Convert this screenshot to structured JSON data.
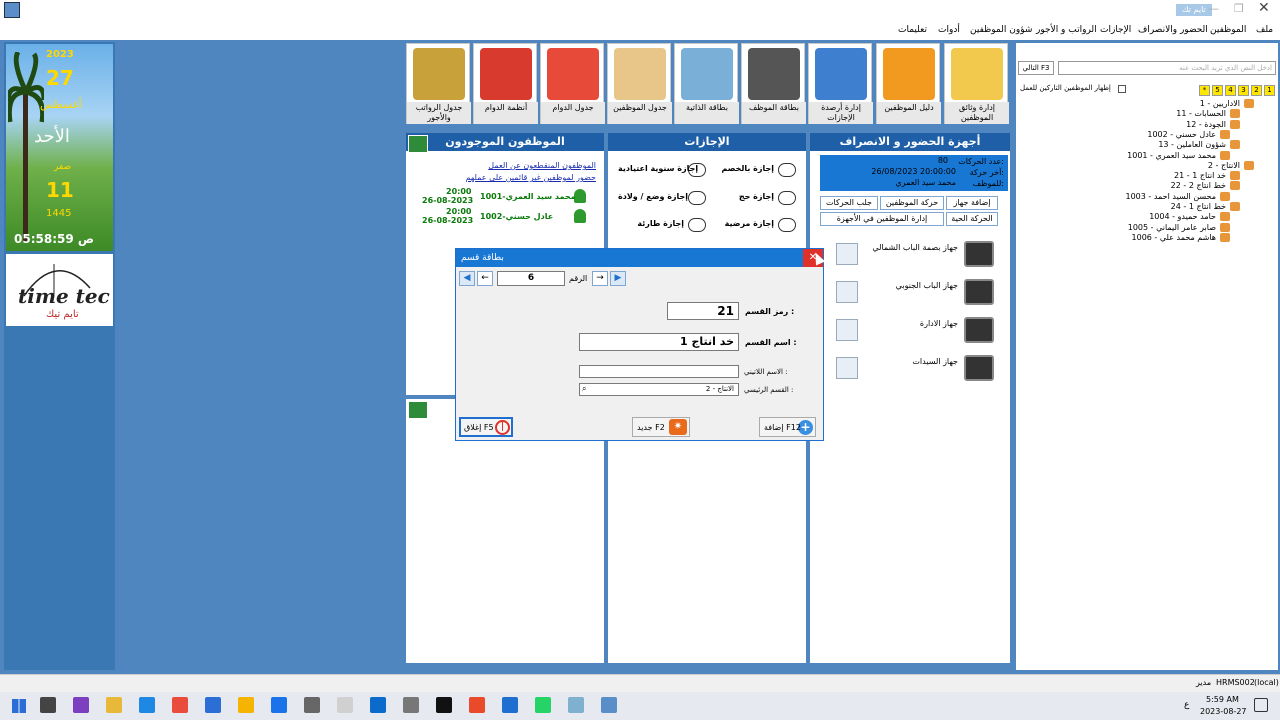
{
  "window": {
    "title": "تايم تك",
    "controls": [
      "✕",
      "❐",
      "—"
    ]
  },
  "menu": {
    "items": [
      "ملف",
      "الموظفين",
      "الحضور والانصراف",
      "الإجازات",
      "الرواتب و الأجور",
      "شؤون الموظفين",
      "أدوات",
      "تعليمات"
    ]
  },
  "date_panel": {
    "year": "2023",
    "day": "27",
    "month": "أغسطس",
    "weekday": "الأحد",
    "hijri_month": "صفر",
    "hijri_day": "11",
    "hijri_year": "1445",
    "time": "05:58:59 ص"
  },
  "logo": {
    "text": "time tec",
    "arabic": "تايم تيك"
  },
  "toolbar": {
    "items": [
      {
        "label": "إدارة وثائق الموظفين",
        "icon": "documents-icon",
        "color": "#f2c94c"
      },
      {
        "label": "دليل الموظفين",
        "icon": "folders-icon",
        "color": "#f29a1f"
      },
      {
        "label": "إدارة أرصدة الإجازات",
        "icon": "binders-icon",
        "color": "#3f7fcf"
      },
      {
        "label": "بطاقة الموظف",
        "icon": "person-icon",
        "color": "#555555"
      },
      {
        "label": "بطاقة الذاتية",
        "icon": "chart-board-icon",
        "color": "#7ab0d8"
      },
      {
        "label": "جدول الموظفين",
        "icon": "id-card-icon",
        "color": "#e8c68a"
      },
      {
        "label": "جدول الدوام",
        "icon": "timesheet-clock-icon",
        "color": "#e84a3a"
      },
      {
        "label": "أنظمة الدوام",
        "icon": "calendar-icon",
        "color": "#d93a2e"
      },
      {
        "label": "جدول الرواتب والأجور",
        "icon": "money-icon",
        "color": "#c9a13a"
      }
    ]
  },
  "attendance": {
    "title": "أجهزة الحضور و الانصراف",
    "stats": {
      "moves_label": "عدد الحركات:",
      "moves_value": "80",
      "last_label": "آخر حركة:",
      "last_value": "26/08/2023 20:00:00",
      "employee_label": "للموظف:",
      "employee_value": "محمد سيد العمري"
    },
    "buttons": [
      "إضافة جهاز",
      "حركة الموظفين",
      "جلب الحركات",
      "الحركة الحية",
      "إدارة الموظفين في الأجهزة"
    ],
    "devices": [
      "جهاز بصمة الباب الشمالي",
      "جهاز الباب الجنوبي",
      "جهاز الادارة",
      "جهاز السيدات"
    ]
  },
  "leaves": {
    "title": "الإجازات",
    "items": [
      "إجازة بالخصم",
      "إجازة سنوية اعتيادية",
      "إجازة حج",
      "إجازة وضع / ولادة",
      "إجازة مرضية",
      "إجازة طارئة"
    ]
  },
  "present": {
    "title": "الموظفون الموجودون",
    "links": [
      "الموظفون المنقطعون عن العمل",
      "حضور لموظفين غير قائمين على عملهم"
    ],
    "rows": [
      {
        "name": "1001-محمد سيد العمري",
        "time": "20:00",
        "date": "26-08-2023"
      },
      {
        "name": "1002-عادل حسني",
        "time": "20:00",
        "date": "26-08-2023"
      }
    ]
  },
  "dialog": {
    "title": "بطاقة قسم",
    "number_label": "الرقم",
    "number_value": "6",
    "code_label": "رمز القسم :",
    "code_value": "21",
    "name_label": "اسم القسم :",
    "name_value": "خد انتاج 1",
    "latin_label": "الاسم اللاتيني :",
    "parent_label": "القسم الرئيسي :",
    "parent_value": "2 - الانتاج",
    "add_label": "إضافة F12",
    "new_label": "جديد F2",
    "close_label": "إغلاق F5"
  },
  "right_panel": {
    "search_placeholder": "ادخل النص الذي تريد البحث عنه",
    "next_label": "التالي F3",
    "show_leavers": "إظهار الموظفين التاركين للعمل",
    "levels": [
      "1",
      "2",
      "3",
      "4",
      "5",
      "*"
    ],
    "tree": [
      "1 - الاداريين",
      "11 - الحسابات",
      "12 - الجودة",
      "1002 - عادل حسني",
      "13 - شؤون العاملين",
      "1001 - محمد سيد العمري",
      "2 - الانتاج",
      "21 - خد انتاج 1",
      "22 - خط انتاج 2",
      "1003 - محسن السيد احمد",
      "24 - خط انتاج 1",
      "1004 - حامد حميدو",
      "1005 - صابر عامر اليماني",
      "1006 - هاشم محمد علي"
    ]
  },
  "status": {
    "db": "HRMS002",
    "server": "(local)",
    "user": "مدير"
  },
  "taskbar": {
    "time": "5:59 AM",
    "date": "2023-08-27",
    "lang": "ع"
  }
}
